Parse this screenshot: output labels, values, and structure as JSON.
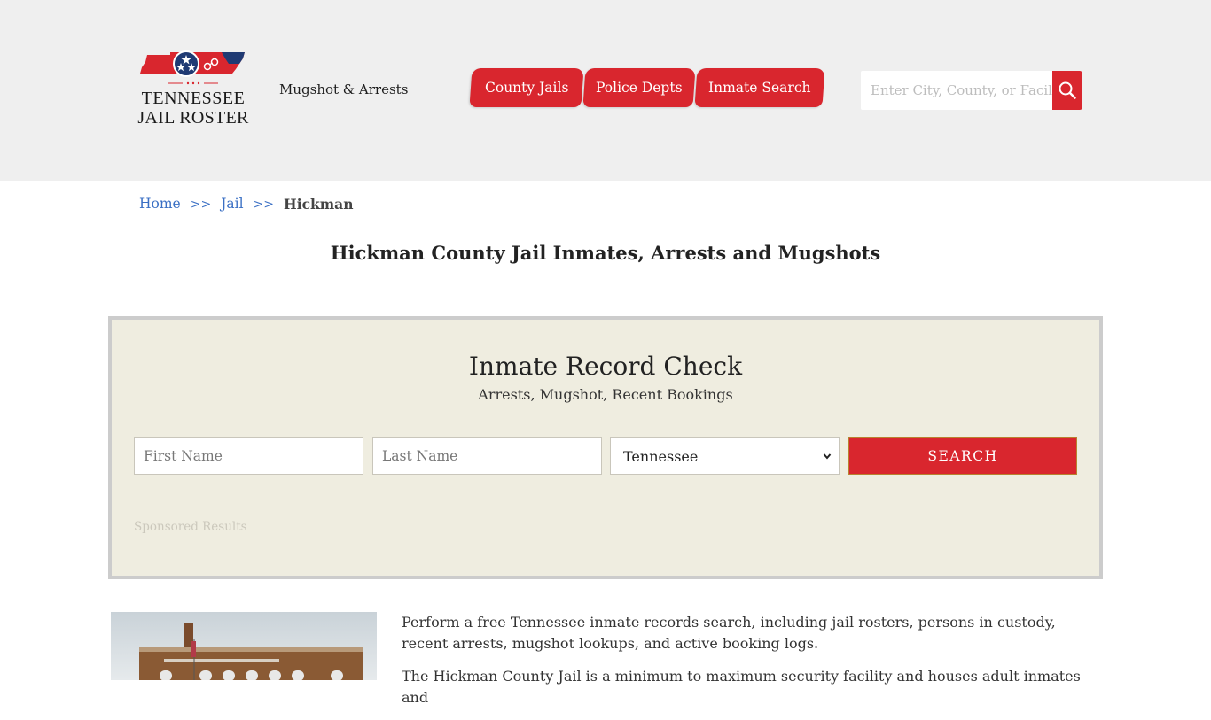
{
  "header": {
    "logo": {
      "line1": "TENNESSEE",
      "line2": "JAIL ROSTER"
    },
    "tagline": "Mugshot & Arrests",
    "nav": [
      {
        "label": "County Jails"
      },
      {
        "label": "Police Depts"
      },
      {
        "label": "Inmate Search"
      }
    ],
    "search": {
      "placeholder": "Enter City, County, or Facility",
      "value": ""
    }
  },
  "breadcrumb": {
    "items": [
      {
        "label": "Home"
      },
      {
        "label": "Jail"
      }
    ],
    "separator": ">>",
    "current": "Hickman"
  },
  "page_title": "Hickman County Jail Inmates, Arrests and Mugshots",
  "record_check": {
    "title": "Inmate Record Check",
    "subtitle": "Arrests, Mugshot, Recent Bookings",
    "first_name": {
      "placeholder": "First Name",
      "value": ""
    },
    "last_name": {
      "placeholder": "Last Name",
      "value": ""
    },
    "state": {
      "selected": "Tennessee"
    },
    "search_label": "SEARCH",
    "sponsored": "Sponsored Results"
  },
  "content": {
    "paragraphs": [
      "Perform a free Tennessee inmate records search, including jail rosters, persons in custody, recent arrests, mugshot lookups, and active booking logs.",
      "The Hickman County Jail is a minimum to maximum security facility and houses adult inmates and"
    ]
  },
  "colors": {
    "brand_red": "#d9262e",
    "header_bg": "#efefef",
    "panel_bg": "#efede0",
    "link_blue": "#3a6fc4"
  }
}
